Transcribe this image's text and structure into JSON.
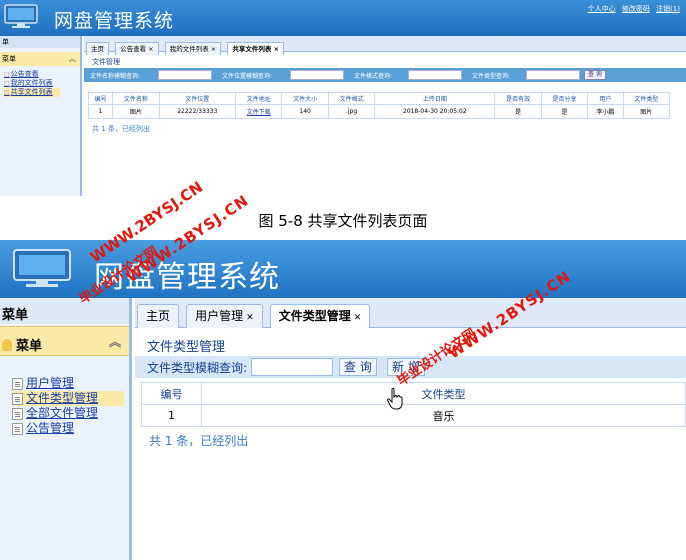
{
  "shot1": {
    "app_title": "网盘管理系统",
    "header_links": [
      "个人中心",
      "修改密码",
      "注销(1)"
    ],
    "sidebar_head": "单",
    "sidebar_menu": "菜单",
    "sidebar_items": [
      "公告查看",
      "我的文件列表",
      "共享文件列表"
    ],
    "tabs": [
      "主页",
      "公告查看 ×",
      "我的文件列表 ×",
      "共享文件列表 ×"
    ],
    "panel_title": "文件管理",
    "search": {
      "name_label": "文件名称模糊查询:",
      "location_label": "文件位置模糊查询:",
      "format_label": "文件格式查询:",
      "type_label": "文件类型查询:",
      "query_button": "查 询"
    },
    "table": {
      "headers": [
        "编号",
        "文件名称",
        "文件位置",
        "文件地址",
        "文件大小",
        "文件格式",
        "上传日期",
        "是否有效",
        "是否分享",
        "用户",
        "文件类型"
      ],
      "rows": [
        [
          "1",
          "图片",
          "22222/33333",
          "文件下载",
          "140",
          ".jpg",
          "2018-04-30 20:05:02",
          "是",
          "是",
          "李小鹏",
          "图片"
        ]
      ]
    },
    "footer": "共 1 条，已经列出"
  },
  "caption": "图 5-8 共享文件列表页面",
  "shot2": {
    "app_title": "网盘管理系统",
    "sidebar_head": "菜单",
    "sidebar_menu": "菜单",
    "sidebar_items": [
      "用户管理",
      "文件类型管理",
      "全部文件管理",
      "公告管理"
    ],
    "tabs": [
      "主页",
      "用户管理",
      "文件类型管理"
    ],
    "panel_title": "文件类型管理",
    "search": {
      "label": "文件类型模糊查询:",
      "query_button": "查 询",
      "new_button": "新 增"
    },
    "table": {
      "headers": [
        "编号",
        "文件类型"
      ],
      "rows": [
        [
          "1",
          "音乐"
        ]
      ]
    },
    "footer": "共 1 条，已经列出"
  },
  "watermarks": {
    "site_url": "WWW.2BYSJ.CN",
    "site_name": "毕业设计论文网"
  },
  "colors": {
    "header_blue": "#1f73c2",
    "menu_yellow": "#fbe9a8",
    "watermark_red": "#e0190e",
    "link_blue": "#1a3fa8"
  }
}
